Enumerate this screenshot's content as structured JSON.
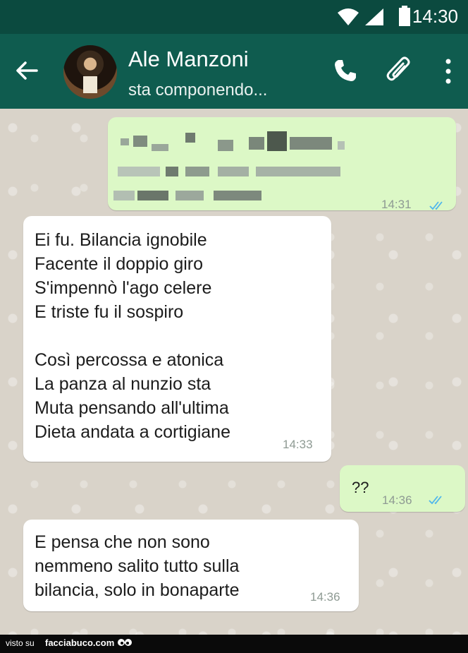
{
  "status_bar": {
    "time": "14:30"
  },
  "header": {
    "contact_name": "Ale Manzoni",
    "contact_status": "sta componendo..."
  },
  "messages": [
    {
      "direction": "outgoing",
      "text": "",
      "time": "14:31",
      "read": true
    },
    {
      "direction": "incoming",
      "text": "Ei fu. Bilancia ignobile\nFacente il doppio giro\nS'impennò l'ago celere\nE triste fu il sospiro\n\nCosì percossa e atonica\nLa panza al nunzio sta\nMuta pensando all'ultima\nDieta andata a cortigiane",
      "time": "14:33"
    },
    {
      "direction": "outgoing",
      "text": "??",
      "time": "14:36",
      "read": true
    },
    {
      "direction": "incoming",
      "text": "E pensa che non sono\nnemmeno salito tutto sulla\nbilancia, solo in bonaparte",
      "time": "14:36"
    }
  ],
  "watermark": {
    "prefix": "visto su",
    "site": "facciabuco.com"
  },
  "colors": {
    "header": "#0f5c4f",
    "status_bar": "#0b4a3f",
    "outgoing_bubble": "#dcf8c6",
    "incoming_bubble": "#ffffff",
    "read_ticks": "#4fb6ec"
  }
}
